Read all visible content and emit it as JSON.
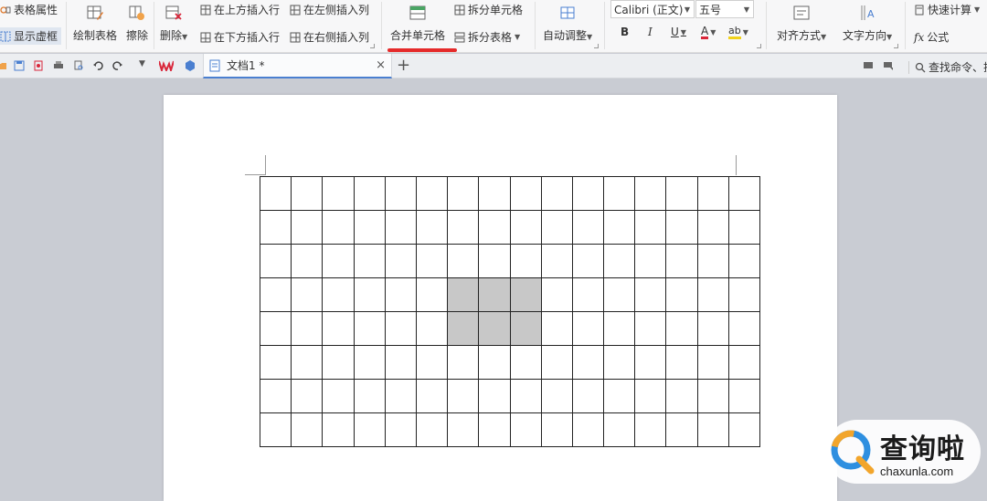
{
  "ribbon": {
    "table_properties": "表格属性",
    "show_virtual_border": "显示虚框",
    "draw_table": "绘制表格",
    "erase": "擦除",
    "delete": "删除",
    "insert_row_above": "在上方插入行",
    "insert_row_below": "在下方插入行",
    "insert_col_left": "在左侧插入列",
    "insert_col_right": "在右侧插入列",
    "merge_cells": "合并单元格",
    "split_cells": "拆分单元格",
    "split_table": "拆分表格",
    "auto_fit": "自动调整",
    "font_name": "Calibri (正文)",
    "font_size": "五号",
    "bold": "B",
    "italic": "I",
    "underline": "U",
    "font_color": "A",
    "highlight": "ab",
    "align": "对齐方式",
    "text_direction": "文字方向",
    "quick_calc": "快速计算",
    "formula_fx": "fx",
    "formula": "公式"
  },
  "tabs": {
    "doc_title": "文档1 *",
    "close_glyph": "×",
    "add_glyph": "+",
    "search_placeholder": "查找命令、搜"
  },
  "table": {
    "rows": 8,
    "cols": 16,
    "selected_rows": [
      3,
      4
    ],
    "selected_cols": [
      6,
      7,
      8
    ]
  },
  "watermark": {
    "cn": "查询啦",
    "en": "chaxunla.com"
  },
  "colors": {
    "accent_red": "#e52a2a",
    "tab_underline": "#4a7fd0",
    "selected_cell": "#c8c8c8",
    "wps_logo": "#d9263a"
  }
}
